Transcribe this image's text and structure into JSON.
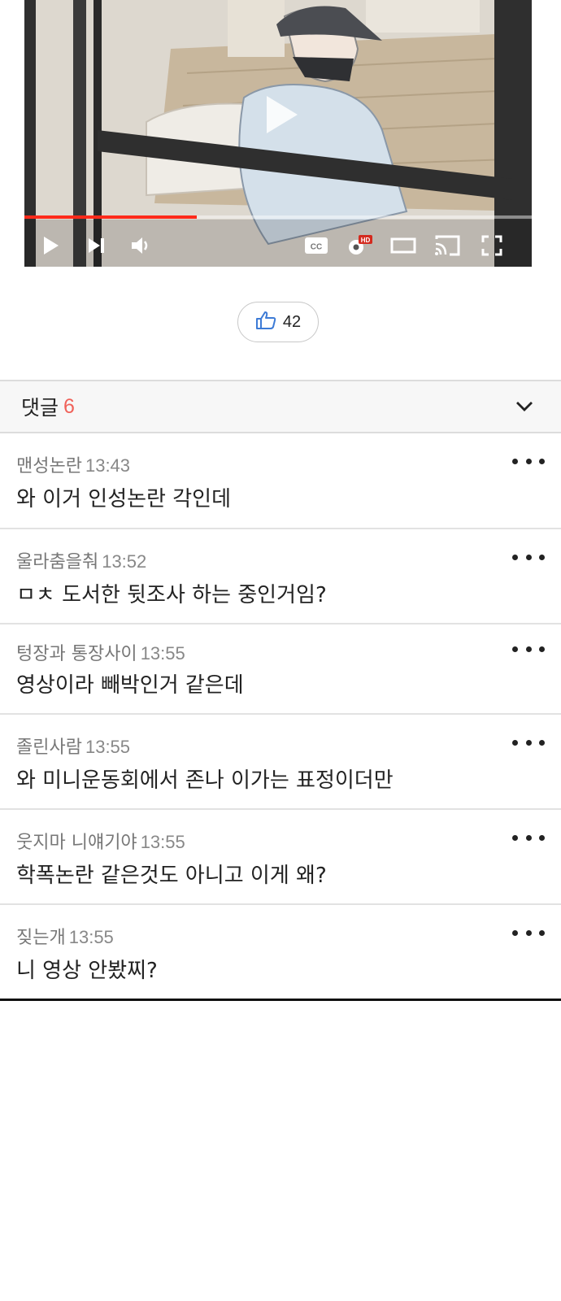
{
  "video": {
    "progress_fraction": 0.34,
    "progress_color": "#ff2a1a",
    "controls": [
      "play-icon",
      "next-icon",
      "volume-icon",
      "captions-icon",
      "settings-hd-icon",
      "theater-mode-icon",
      "cast-icon",
      "fullscreen-icon"
    ],
    "hd_badge": "HD",
    "cc_label": "CC"
  },
  "like": {
    "icon": "thumbs-up-icon",
    "count": "42"
  },
  "comments_header": {
    "title": "댓글",
    "count": "6",
    "count_color": "#f0625a",
    "toggle_icon": "chevron-down-icon"
  },
  "comments": [
    {
      "author": "맨성논란",
      "time": "13:43",
      "text": "와 이거 인성논란 각인데"
    },
    {
      "author": "울라춤을춰",
      "time": "13:52",
      "text": "ㅁㅊ 도서한 뒷조사 하는 중인거임?"
    },
    {
      "author": "텅장과 통장사이",
      "time": "13:55",
      "text": "영상이라 빼박인거 같은데"
    },
    {
      "author": "졸린사람",
      "time": "13:55",
      "text": "와 미니운동회에서 존나 이가는 표정이더만"
    },
    {
      "author": "웃지마 니얘기야",
      "time": "13:55",
      "text": "학폭논란 같은것도 아니고 이게 왜?"
    },
    {
      "author": "짖는개",
      "time": "13:55",
      "text": "니 영상 안봤찌?"
    }
  ]
}
